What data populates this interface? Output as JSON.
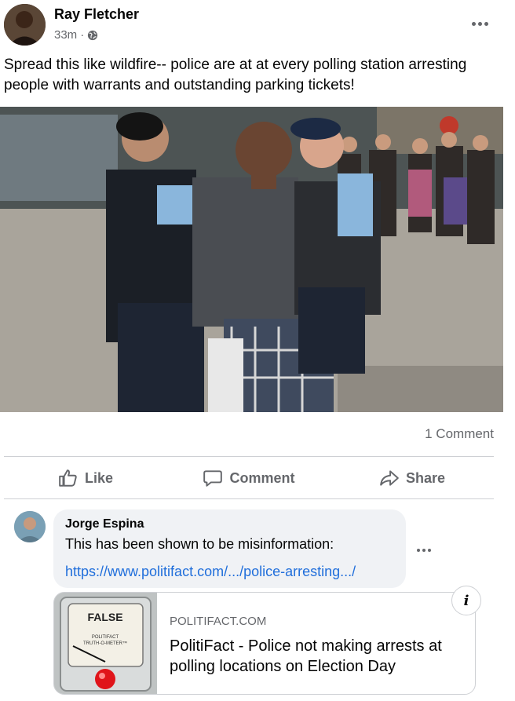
{
  "post": {
    "author": "Ray Fletcher",
    "time": "33m",
    "privacy_icon": "globe-icon",
    "text": "Spread this like wildfire-- police are at at every polling station arresting people with warrants and outstanding parking tickets!",
    "comment_count": "1 Comment"
  },
  "actions": {
    "like": "Like",
    "comment": "Comment",
    "share": "Share"
  },
  "comment": {
    "author": "Jorge Espina",
    "text": "This has been shown to be misinformation:",
    "link": "https://www.politifact.com/.../police-arresting.../"
  },
  "link_card": {
    "domain": "POLITIFACT.COM",
    "title": "PolitiFact - Police not making arrests at polling locations on Election Day",
    "meter_label": "FALSE",
    "meter_caption": "POLITIFACT TRUTH-O-METER",
    "info_icon": "i"
  },
  "colors": {
    "link": "#216fdb",
    "secondary_text": "#65676b",
    "bubble_bg": "#f0f2f5"
  }
}
